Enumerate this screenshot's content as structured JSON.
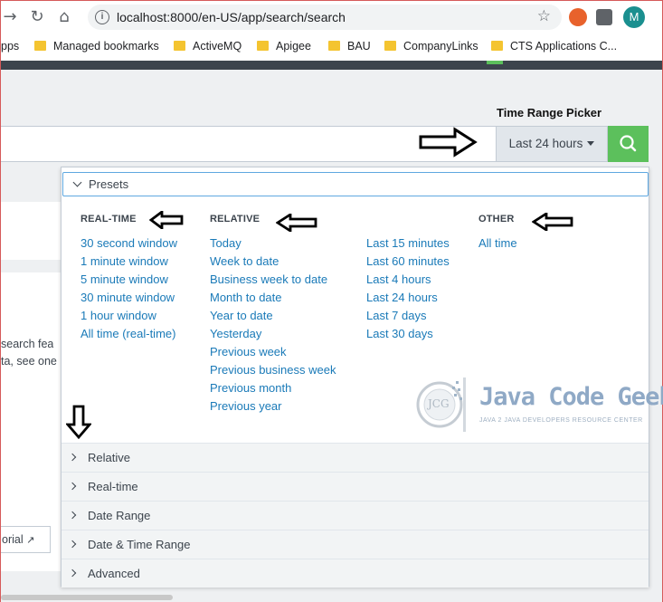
{
  "browser": {
    "url": "localhost:8000/en-US/app/search/search",
    "avatar_letter": "M",
    "bookmarks": [
      "pps",
      "Managed bookmarks",
      "ActiveMQ",
      "Apigee",
      "BAU",
      "CompanyLinks",
      "CTS Applications C..."
    ]
  },
  "annotation": {
    "picker_title": "Time Range Picker"
  },
  "search": {
    "time_range_value": "Last 24 hours"
  },
  "background_fragments": {
    "line1": "search fea",
    "line2": "ta, see one",
    "tutorial_button": "orial"
  },
  "presets": {
    "header": "Presets",
    "columns": {
      "realtime": {
        "heading": "REAL-TIME",
        "items": [
          "30 second window",
          "1 minute window",
          "5 minute window",
          "30 minute window",
          "1 hour window",
          "All time (real-time)"
        ]
      },
      "relative": {
        "heading": "RELATIVE",
        "items": [
          "Today",
          "Week to date",
          "Business week to date",
          "Month to date",
          "Year to date",
          "Yesterday",
          "Previous week",
          "Previous business week",
          "Previous month",
          "Previous year"
        ]
      },
      "relative2": {
        "items": [
          "Last 15 minutes",
          "Last 60 minutes",
          "Last 4 hours",
          "Last 24 hours",
          "Last 7 days",
          "Last 30 days"
        ]
      },
      "other": {
        "heading": "OTHER",
        "items": [
          "All time"
        ]
      }
    }
  },
  "sections": [
    "Relative",
    "Real-time",
    "Date Range",
    "Date & Time Range",
    "Advanced"
  ],
  "watermark": {
    "logo_text": "JCG",
    "title": "Java Code Geeks",
    "tagline": "Java 2 Java Developers Resource Center"
  },
  "colors": {
    "accent_green": "#5cc05c",
    "link_blue": "#1a7ab8",
    "focus_blue": "#5fa8e0"
  }
}
